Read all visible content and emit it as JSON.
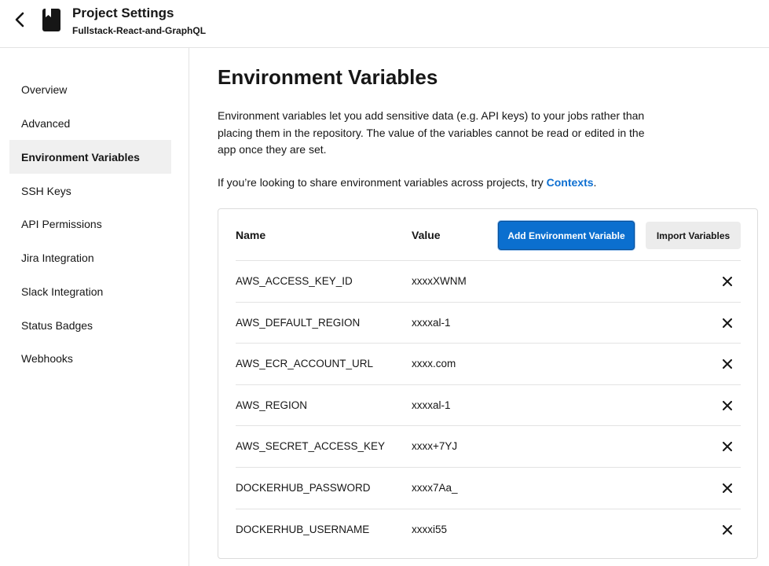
{
  "header": {
    "title": "Project Settings",
    "subtitle": "Fullstack-React-and-GraphQL",
    "back_icon": "chevron-left-icon",
    "project_icon": "book-icon"
  },
  "sidebar": {
    "items": [
      {
        "label": "Overview",
        "active": false
      },
      {
        "label": "Advanced",
        "active": false
      },
      {
        "label": "Environment Variables",
        "active": true
      },
      {
        "label": "SSH Keys",
        "active": false
      },
      {
        "label": "API Permissions",
        "active": false
      },
      {
        "label": "Jira Integration",
        "active": false
      },
      {
        "label": "Slack Integration",
        "active": false
      },
      {
        "label": "Status Badges",
        "active": false
      },
      {
        "label": "Webhooks",
        "active": false
      }
    ]
  },
  "main": {
    "title": "Environment Variables",
    "description": "Environment variables let you add sensitive data (e.g. API keys) to your jobs rather than placing them in the repository. The value of the variables cannot be read or edited in the app once they are set.",
    "share_text": "If you’re looking to share environment variables across projects, try ",
    "contexts_link": "Contexts",
    "share_suffix": "."
  },
  "table": {
    "headers": {
      "name": "Name",
      "value": "Value"
    },
    "add_button": "Add Environment Variable",
    "import_button": "Import Variables",
    "rows": [
      {
        "name": "AWS_ACCESS_KEY_ID",
        "value": "xxxxXWNM"
      },
      {
        "name": "AWS_DEFAULT_REGION",
        "value": "xxxxal-1"
      },
      {
        "name": "AWS_ECR_ACCOUNT_URL",
        "value": "xxxx.com"
      },
      {
        "name": "AWS_REGION",
        "value": "xxxxal-1"
      },
      {
        "name": "AWS_SECRET_ACCESS_KEY",
        "value": "xxxx+7YJ"
      },
      {
        "name": "DOCKERHUB_PASSWORD",
        "value": "xxxx7Aa_"
      },
      {
        "name": "DOCKERHUB_USERNAME",
        "value": "xxxxi55"
      }
    ],
    "delete_icon": "close-icon"
  },
  "colors": {
    "accent": "#0b6fcf",
    "link": "#0d6fd1",
    "active_bg": "#f0f0f0",
    "border": "#e3e3e3"
  }
}
